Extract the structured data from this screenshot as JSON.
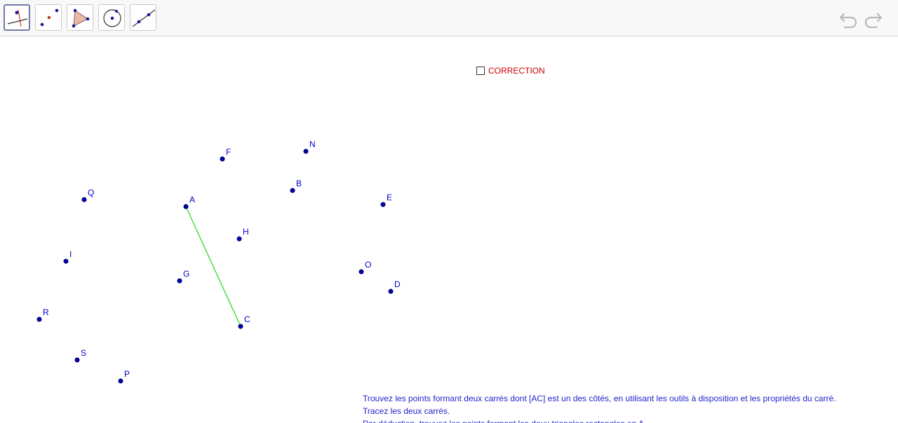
{
  "toolbar": {
    "tools": [
      {
        "name": "move",
        "active": true
      },
      {
        "name": "point"
      },
      {
        "name": "polygon"
      },
      {
        "name": "circle"
      },
      {
        "name": "line"
      }
    ],
    "icons": {
      "undo": "undo-icon",
      "redo": "redo-icon"
    }
  },
  "checkbox": {
    "label": "CORRECTION",
    "checked": false,
    "label_color": "#cc0000"
  },
  "points": [
    {
      "name": "F"
    },
    {
      "name": "N"
    },
    {
      "name": "Q"
    },
    {
      "name": "B"
    },
    {
      "name": "A"
    },
    {
      "name": "E"
    },
    {
      "name": "H"
    },
    {
      "name": "I"
    },
    {
      "name": "O"
    },
    {
      "name": "G"
    },
    {
      "name": "D"
    },
    {
      "name": "R"
    },
    {
      "name": "C"
    },
    {
      "name": "S"
    },
    {
      "name": "P"
    }
  ],
  "segment": {
    "from": "A",
    "to": "C",
    "color": "#44e044"
  },
  "point_color": "#0000aa",
  "instructions": [
    "Trouvez les points formant deux carrés dont [AC] est un des côtés, en utilisant les outils à disposition et les propriétés du carré.",
    "Tracez les deux carrés.",
    "Par déduction, trouvez les points formant les deux triangles rectangles en A."
  ]
}
